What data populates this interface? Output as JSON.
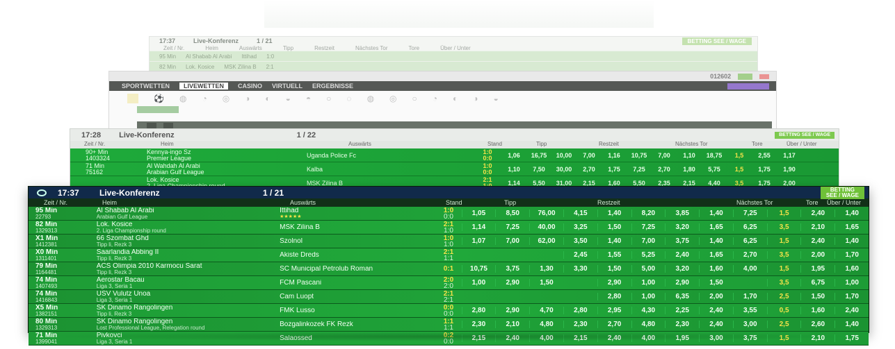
{
  "layer1": {
    "time": "17:37",
    "title": "Live-Konferenz",
    "count": "1 / 21",
    "badge": "BETTING SEE / WAGE",
    "columns": [
      "Zeit / Nr.",
      "Heim",
      "Auswärts",
      "Tipp",
      "Restzeit",
      "Nächstes Tor",
      "Tore",
      "Über / Unter"
    ],
    "rows": [
      {
        "time": "95 Min",
        "home": "Al Shabab Al Arabi",
        "away": "Ittihad",
        "score": "1:0"
      },
      {
        "time": "82 Min",
        "home": "Lok. Kosice",
        "away": "MSK Zilina B",
        "score": "2:1"
      }
    ]
  },
  "layer2": {
    "id_number": "012602",
    "nav": [
      "SPORTWETTEN",
      "LIVEWETTEN",
      "CASINO",
      "VIRTUELL",
      "ERGEBNISSE"
    ],
    "active_tab": "LIVEWETTEN"
  },
  "layer3": {
    "time": "17:28",
    "title": "Live-Konferenz",
    "count": "1 / 22",
    "badge": "BETTING SEE / WAGE",
    "columns": [
      "Zeit / Nr.",
      "Heim",
      "Auswärts",
      "Stand",
      "Tipp",
      "Restzeit",
      "Nächstes Tor",
      "Tore",
      "Über / Unter"
    ],
    "rows": [
      {
        "time": "90+ Min",
        "no": "1403324",
        "home": "Kennya-ingo Sz",
        "league": "Premier League",
        "away": "Uganda Police Fc",
        "score": "1:0",
        "half": "0:0",
        "odds": [
          "1,06",
          "16,75",
          "10,00",
          "7,00",
          "1,16",
          "10,75",
          "7,00",
          "1,10",
          "18,75",
          "1,5",
          "2,55",
          "1,17"
        ]
      },
      {
        "time": "71 Min",
        "no": "75162",
        "home": "Al Wahdah Al Arabi",
        "league": "Arabian Gulf League",
        "away": "Kalba",
        "score": "1:0",
        "half": "0:0",
        "odds": [
          "1,10",
          "7,50",
          "30,00",
          "2,70",
          "1,75",
          "7,25",
          "2,70",
          "1,80",
          "5,75",
          "1,5",
          "1,75",
          "1,90"
        ]
      },
      {
        "time": "",
        "no": "",
        "home": "Lok. Kosice",
        "league": "2. Liga Championship round",
        "away": "MSK Zilina B",
        "score": "2:1",
        "half": "1:0",
        "odds": [
          "1,14",
          "5,50",
          "31,00",
          "2,15",
          "1,60",
          "5,50",
          "2,35",
          "2,15",
          "4,40",
          "3,5",
          "1,75",
          "2,00"
        ]
      }
    ]
  },
  "main": {
    "time": "17:37",
    "title": "Live-Konferenz",
    "count": "1 / 21",
    "badge_line1": "BETTING",
    "badge_line2": "SEE / WAGE",
    "columns": {
      "time": "Zeit / Nr.",
      "home": "Heim",
      "away": "Auswärts",
      "score": "Stand",
      "tipp": "Tipp",
      "rest": "Restzeit",
      "next": "Nächstes Tor",
      "goals": "Tore",
      "ou": "Über / Unter"
    },
    "rows": [
      {
        "time": "95 Min",
        "no": "22793",
        "home": "Al Shabab Al Arabi",
        "league": "Arabian Gulf League",
        "away": "Ittihad",
        "stars": "★★★★★",
        "score": "1:0",
        "half": "0:0",
        "odds": [
          "1,05",
          "8,50",
          "76,00",
          "4,15",
          "1,40",
          "8,20",
          "3,85",
          "1,40",
          "7,25",
          "1,5",
          "2,40",
          "1,40"
        ]
      },
      {
        "time": "82 Min",
        "no": "1329313",
        "home": "Lok. Kosice",
        "league": "2. Liga Championship round",
        "away": "MSK Zilina B",
        "stars": "",
        "score": "2:1",
        "half": "1:0",
        "odds": [
          "1,14",
          "7,25",
          "40,00",
          "3,25",
          "1,50",
          "7,25",
          "3,20",
          "1,65",
          "6,25",
          "3,5",
          "2,10",
          "1,65"
        ]
      },
      {
        "time": "X1 Min",
        "no": "1412381",
        "home": "66 Szombat Ghd",
        "league": "Tipp li, Rezk 3",
        "away": "Szolnol",
        "stars": "",
        "score": "1:0",
        "half": "1:0",
        "odds": [
          "1,07",
          "7,00",
          "62,00",
          "3,50",
          "1,40",
          "7,00",
          "3,75",
          "1,40",
          "6,25",
          "1,5",
          "2,40",
          "1,40"
        ]
      },
      {
        "time": "X0 Min",
        "no": "1311401",
        "home": "Saarlandia Abbing II",
        "league": "Tipp li, Rezk 3",
        "away": "Akiste Dreds",
        "stars": "",
        "score": "2:1",
        "half": "1:1",
        "odds": [
          "",
          "",
          "",
          "2,45",
          "1,55",
          "5,25",
          "2,40",
          "1,65",
          "2,70",
          "3,5",
          "2,00",
          "1,70"
        ]
      },
      {
        "time": "79 Min",
        "no": "1164481",
        "home": "ACS Olimpia 2010 Karmocu Sarat",
        "league": "Tipp li, Rezk 3",
        "away": "SC Municipal Petrolub Roman",
        "stars": "",
        "score": "0:1",
        "half": "",
        "odds": [
          "10,75",
          "3,75",
          "1,30",
          "3,30",
          "1,50",
          "5,00",
          "3,20",
          "1,60",
          "4,00",
          "1,5",
          "1,95",
          "1,60"
        ]
      },
      {
        "time": "74 Min",
        "no": "1407493",
        "home": "Aerostar Bacau",
        "league": "Liga 3, Seria 1",
        "away": "FCM Pascani",
        "stars": "",
        "score": "2:0",
        "half": "2:0",
        "odds": [
          "1,00",
          "2,90",
          "1,50",
          "",
          "2,90",
          "1,00",
          "2,90",
          "1,50",
          "",
          "3,5",
          "6,75",
          "1,00"
        ]
      },
      {
        "time": "74 Min",
        "no": "1416843",
        "home": "USV Vulutz Unoa",
        "league": "Liga 3, Seria 1",
        "away": "Cam Luopt",
        "stars": "",
        "score": "2:1",
        "half": "2:1",
        "odds": [
          "",
          "",
          "",
          "",
          "2,80",
          "1,00",
          "6,35",
          "2,00",
          "1,70",
          "2,5",
          "1,50",
          "1,70"
        ]
      },
      {
        "time": "X5 Min",
        "no": "1382151",
        "home": "SK Dinamo Rangolingen",
        "league": "Tipp li, Rezk 3",
        "away": "FMK Lusso",
        "stars": "",
        "score": "0:0",
        "half": "0:0",
        "odds": [
          "2,80",
          "2,90",
          "4,70",
          "2,80",
          "2,95",
          "4,30",
          "2,25",
          "2,40",
          "3,55",
          "0,5",
          "1,60",
          "2,40"
        ]
      },
      {
        "time": "80 Min",
        "no": "1329313",
        "home": "SK Dinamo Rangolingen",
        "league": "Lost Professional League, Relegation round",
        "away": "Bozgalinkozek FK Rezk",
        "stars": "",
        "score": "1:1",
        "half": "1:1",
        "odds": [
          "2,30",
          "2,10",
          "4,80",
          "2,30",
          "2,70",
          "4,80",
          "2,30",
          "2,40",
          "3,00",
          "2,5",
          "2,60",
          "1,40"
        ]
      },
      {
        "time": "71 Min",
        "no": "1399041",
        "home": "Pivkovci",
        "league": "Liga 3, Seria 1",
        "away": "Salaossed",
        "stars": "",
        "score": "0:2",
        "half": "0:0",
        "odds": [
          "2,15",
          "2,40",
          "4,00",
          "2,15",
          "2,40",
          "4,00",
          "1,95",
          "3,00",
          "3,75",
          "1,5",
          "2,10",
          "1,75"
        ]
      }
    ]
  }
}
